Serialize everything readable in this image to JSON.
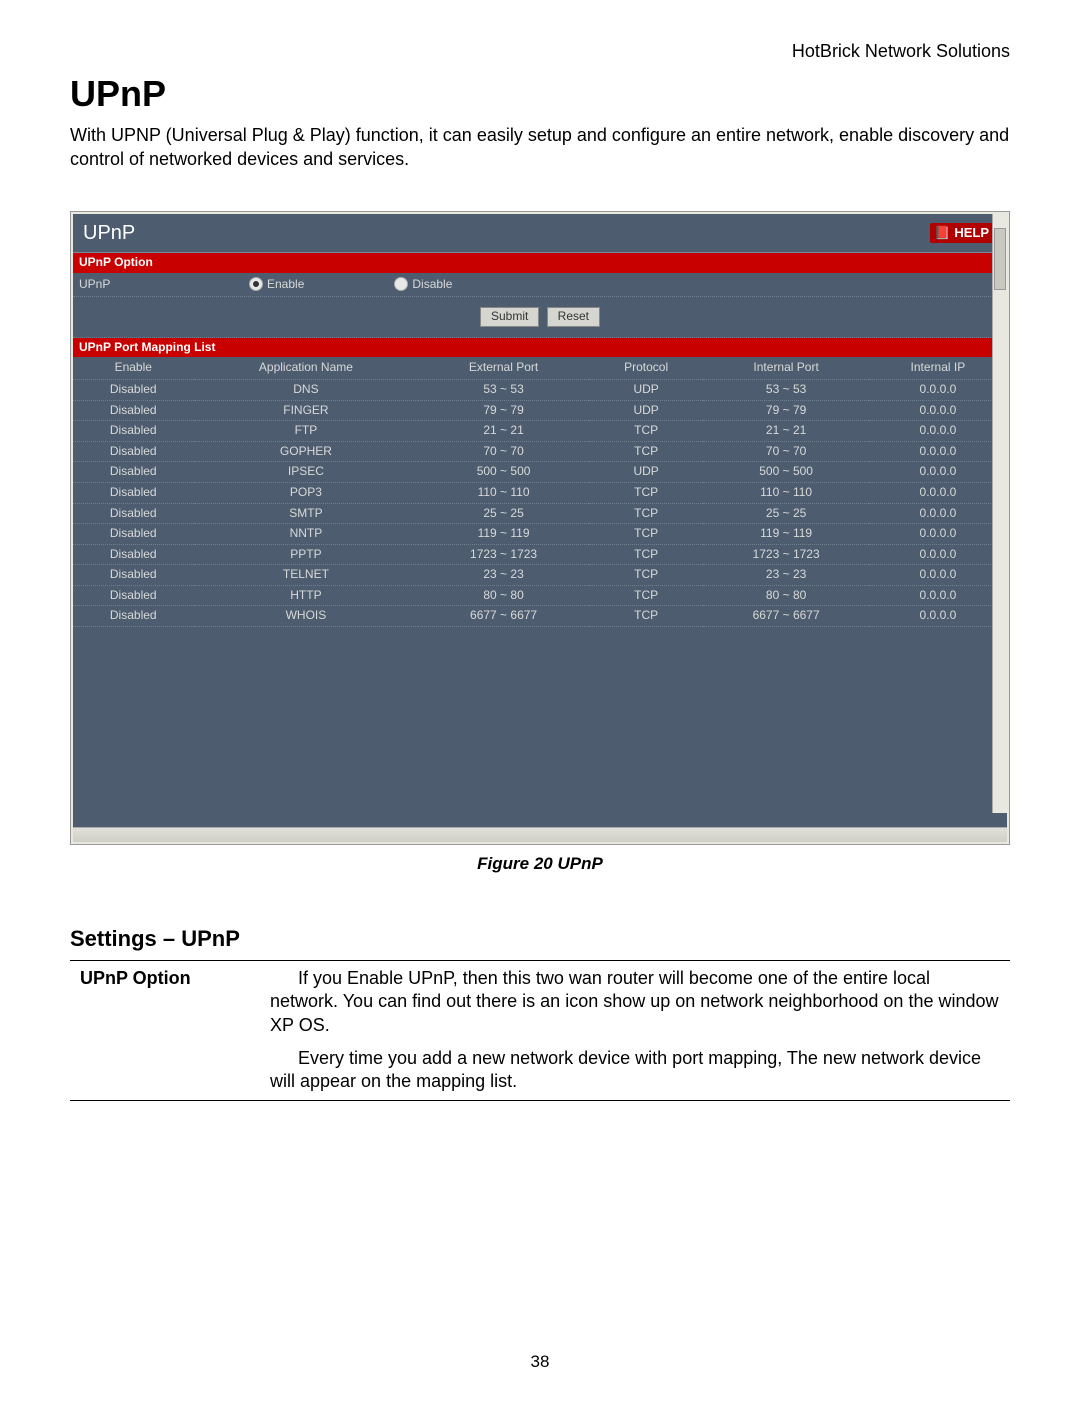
{
  "doc": {
    "brand": "HotBrick Network Solutions",
    "h1": "UPnP",
    "intro": "With UPNP (Universal Plug & Play) function, it can easily setup and configure an entire network, enable discovery and control of networked devices and services.",
    "figcap": "Figure 20 UPnP",
    "h2": "Settings – UPnP",
    "pagenum": "38"
  },
  "shot": {
    "title": "UPnP",
    "help": "HELP",
    "section_option": "UPnP Option",
    "opt_label": "UPnP",
    "radio_enable": "Enable",
    "radio_disable": "Disable",
    "radio_checked": "enable",
    "btn_submit": "Submit",
    "btn_reset": "Reset",
    "section_list": "UPnP Port Mapping List",
    "headers": [
      "Enable",
      "Application Name",
      "External Port",
      "Protocol",
      "Internal Port",
      "Internal IP"
    ],
    "rows": [
      [
        "Disabled",
        "DNS",
        "53 ~ 53",
        "UDP",
        "53 ~ 53",
        "0.0.0.0"
      ],
      [
        "Disabled",
        "FINGER",
        "79 ~ 79",
        "UDP",
        "79 ~ 79",
        "0.0.0.0"
      ],
      [
        "Disabled",
        "FTP",
        "21 ~ 21",
        "TCP",
        "21 ~ 21",
        "0.0.0.0"
      ],
      [
        "Disabled",
        "GOPHER",
        "70 ~ 70",
        "TCP",
        "70 ~ 70",
        "0.0.0.0"
      ],
      [
        "Disabled",
        "IPSEC",
        "500 ~ 500",
        "UDP",
        "500 ~ 500",
        "0.0.0.0"
      ],
      [
        "Disabled",
        "POP3",
        "110 ~ 110",
        "TCP",
        "110 ~ 110",
        "0.0.0.0"
      ],
      [
        "Disabled",
        "SMTP",
        "25 ~ 25",
        "TCP",
        "25 ~ 25",
        "0.0.0.0"
      ],
      [
        "Disabled",
        "NNTP",
        "119 ~ 119",
        "TCP",
        "119 ~ 119",
        "0.0.0.0"
      ],
      [
        "Disabled",
        "PPTP",
        "1723 ~ 1723",
        "TCP",
        "1723 ~ 1723",
        "0.0.0.0"
      ],
      [
        "Disabled",
        "TELNET",
        "23 ~ 23",
        "TCP",
        "23 ~ 23",
        "0.0.0.0"
      ],
      [
        "Disabled",
        "HTTP",
        "80 ~ 80",
        "TCP",
        "80 ~ 80",
        "0.0.0.0"
      ],
      [
        "Disabled",
        "WHOIS",
        "6677 ~ 6677",
        "TCP",
        "6677 ~ 6677",
        "0.0.0.0"
      ]
    ]
  },
  "settings": {
    "row_label": "UPnP Option",
    "p1": "If you Enable UPnP, then this two wan router will become one of the entire local network. You can find out there is an icon show up on network neighborhood on the window XP OS.",
    "p2": "Every time you add a new network device with port mapping, The new network device will appear on the mapping list."
  }
}
